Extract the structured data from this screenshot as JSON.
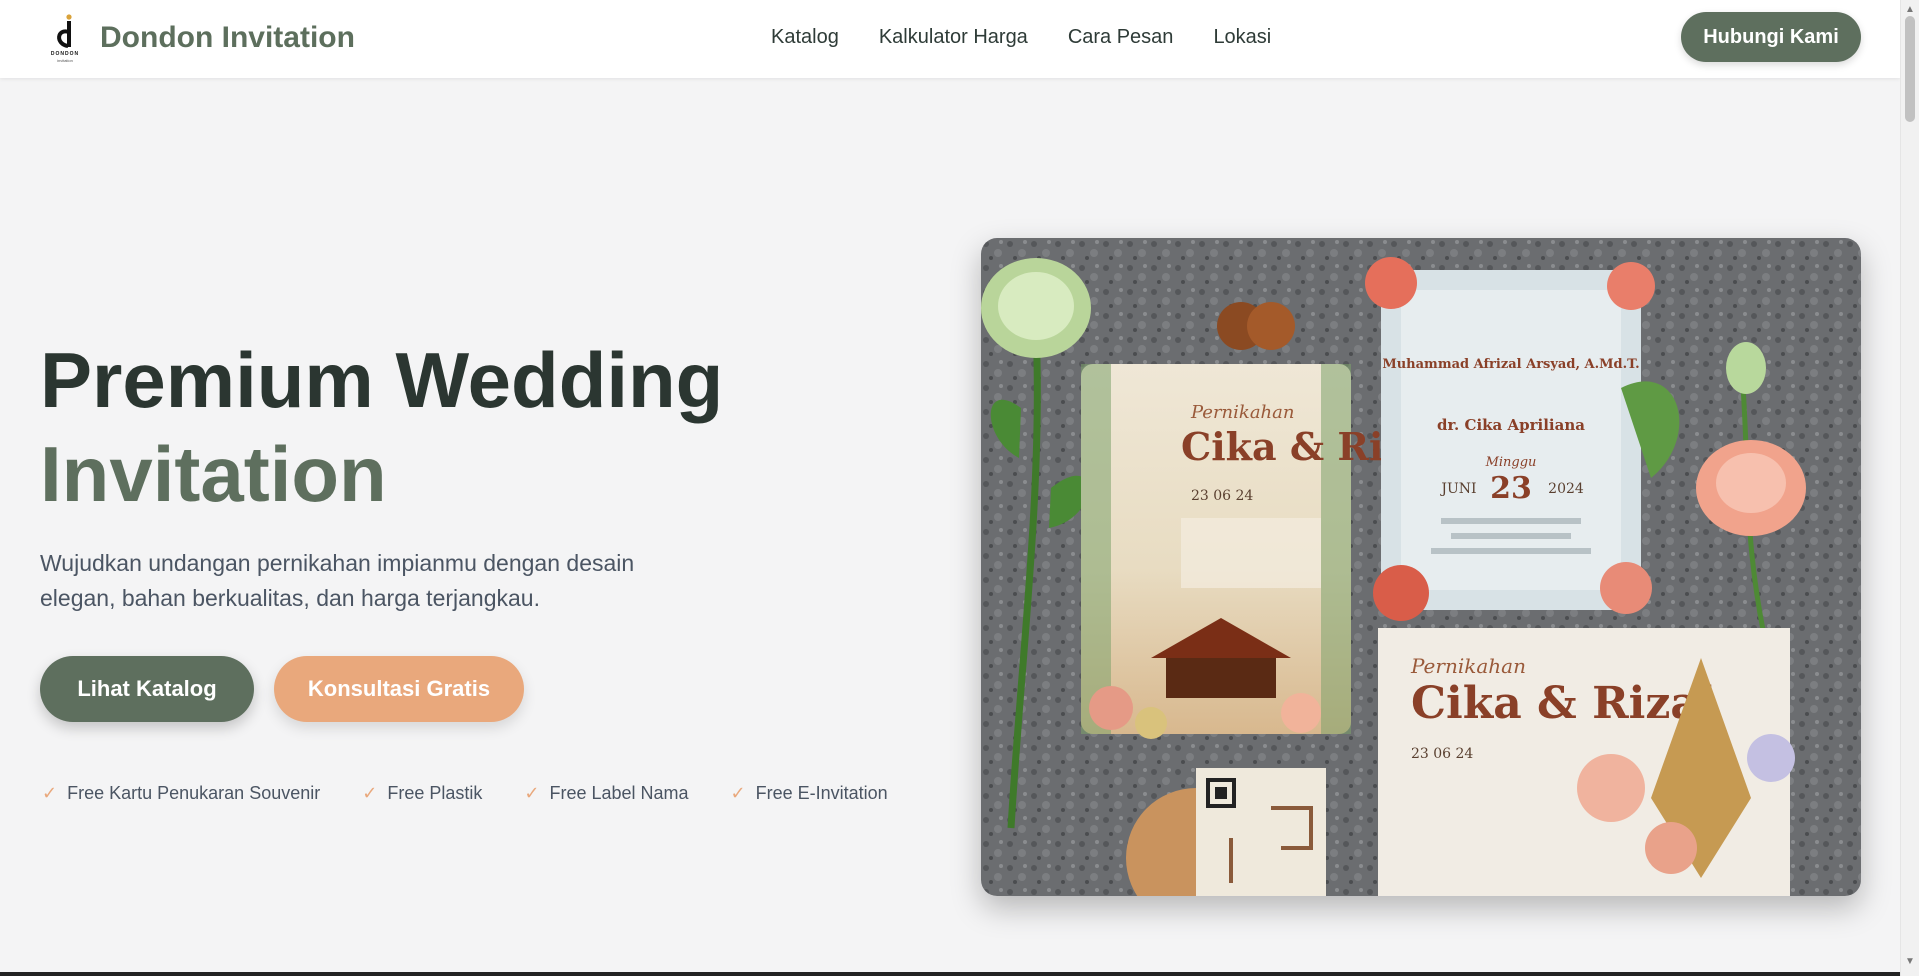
{
  "header": {
    "brand_name": "Dondon Invitation",
    "logo_text": "DONDON",
    "logo_subtext": "invitation",
    "nav": [
      "Katalog",
      "Kalkulator Harga",
      "Cara Pesan",
      "Lokasi"
    ],
    "contact_button": "Hubungi Kami"
  },
  "hero": {
    "title_line1": "Premium Wedding",
    "title_line2": "Invitation",
    "description": "Wujudkan undangan pernikahan impianmu dengan desain elegan, bahan berkualitas, dan harga terjangkau.",
    "primary_button": "Lihat Katalog",
    "secondary_button": "Konsultasi Gratis",
    "features": [
      "Free Kartu Penukaran Souvenir",
      "Free Plastik",
      "Free Label Nama",
      "Free E-Invitation"
    ]
  },
  "photo": {
    "card1_script": "Pernikahan",
    "card1_names": "Cika & Rizal",
    "card1_date": "23 06 24",
    "card2_groom": "Muhammad Afrizal Arsyad, A.Md.T.",
    "card2_bride": "dr. Cika Apriliana",
    "card2_day": "Minggu",
    "card2_date": "23",
    "card2_month": "JUNI",
    "card2_year": "2024",
    "card3_script": "Pernikahan",
    "card3_names": "Cika & Rizal",
    "card3_date": "23 06 24"
  },
  "colors": {
    "brand_green": "#5e6f5e",
    "accent_peach": "#e9a87c",
    "heading_dark": "#2b3631",
    "background": "#f4f4f5"
  }
}
